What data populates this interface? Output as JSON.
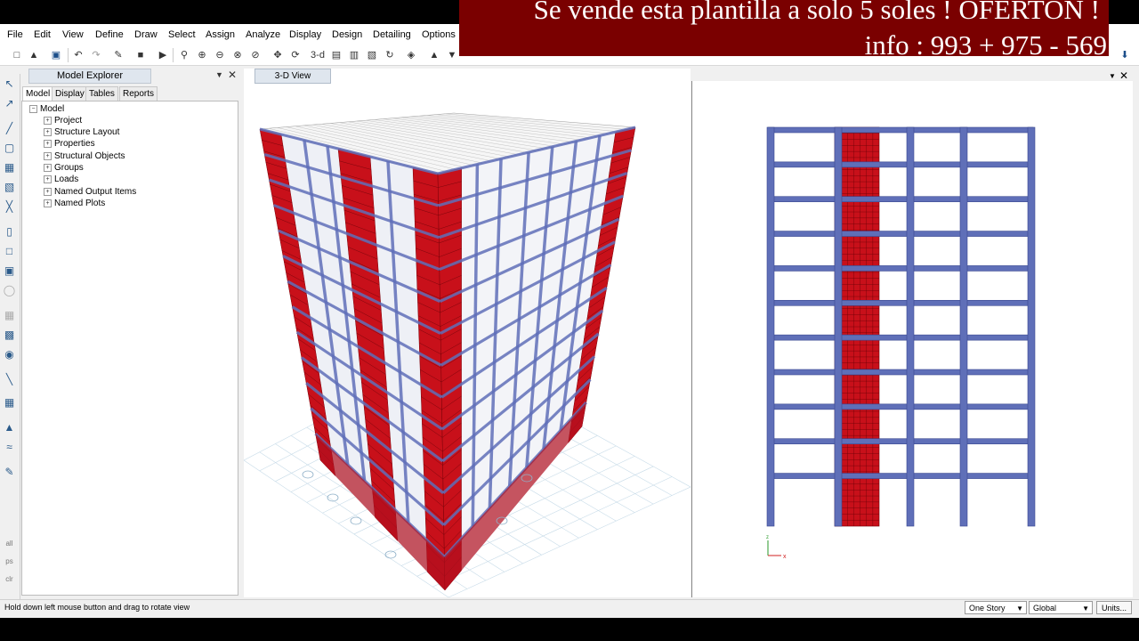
{
  "menu": {
    "items": [
      "File",
      "Edit",
      "View",
      "Define",
      "Draw",
      "Select",
      "Assign",
      "Analyze",
      "Display",
      "Design",
      "Detailing",
      "Options"
    ]
  },
  "overlay": {
    "line1": "Se vende esta plantilla a solo 5 soles ! OFERTON !",
    "line2": "info : 993 + 975 - 569"
  },
  "toolbar": {
    "label_3d": "3-d"
  },
  "explorer": {
    "title": "Model Explorer",
    "tabs": [
      "Model",
      "Display",
      "Tables",
      "Reports"
    ],
    "tree_root": "Model",
    "tree_items": [
      "Project",
      "Structure Layout",
      "Properties",
      "Structural Objects",
      "Groups",
      "Loads",
      "Named Output Items",
      "Named Plots"
    ]
  },
  "views": {
    "tab_3d": "3-D View",
    "axis_x": "x",
    "axis_z": "z"
  },
  "statusbar": {
    "message": "Hold down left mouse button and drag to rotate view",
    "story_option": "One Story",
    "coord_system": "Global",
    "units_label": "Units..."
  },
  "colors": {
    "frame": "#5f6fb8",
    "wall": "#c8101a",
    "ad_bg": "#7a0000"
  },
  "icons": [
    "file-new-icon",
    "open-icon",
    "save-icon",
    "undo-icon",
    "redo-icon",
    "pencil-icon",
    "lock-icon",
    "run-icon",
    "zoom-window-icon",
    "zoom-in-icon",
    "zoom-out-icon",
    "zoom-extents-icon",
    "pan-icon",
    "rotate-icon",
    "download-icon"
  ]
}
